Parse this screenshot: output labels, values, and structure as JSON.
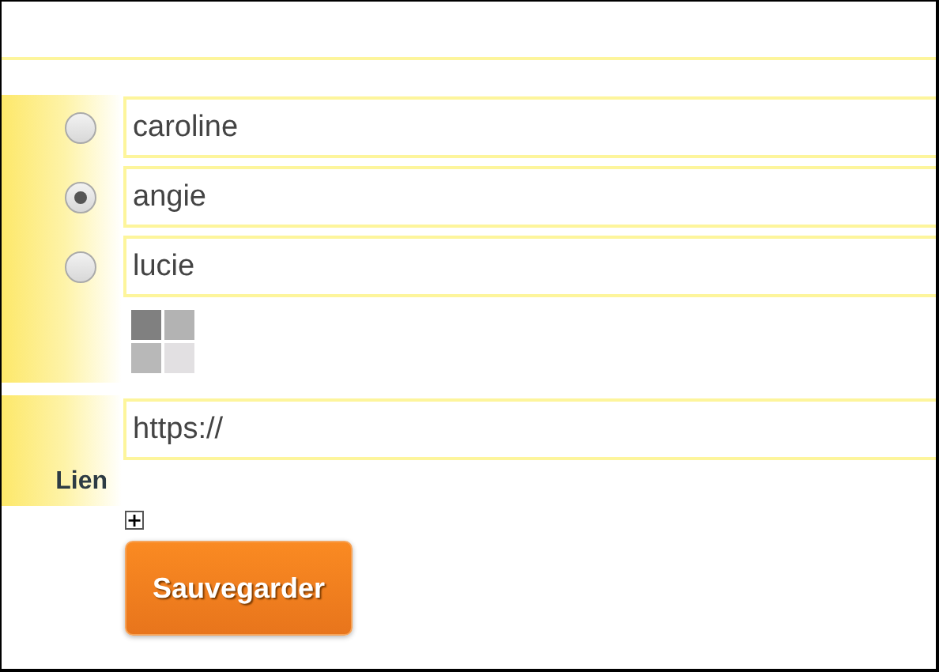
{
  "options": [
    {
      "value": "caroline",
      "selected": false
    },
    {
      "value": "angie",
      "selected": true
    },
    {
      "value": "lucie",
      "selected": false
    }
  ],
  "link": {
    "label": "Lien",
    "value": "https://"
  },
  "add_button": {
    "label": "+"
  },
  "save_button": {
    "label": "Sauvegarder"
  }
}
